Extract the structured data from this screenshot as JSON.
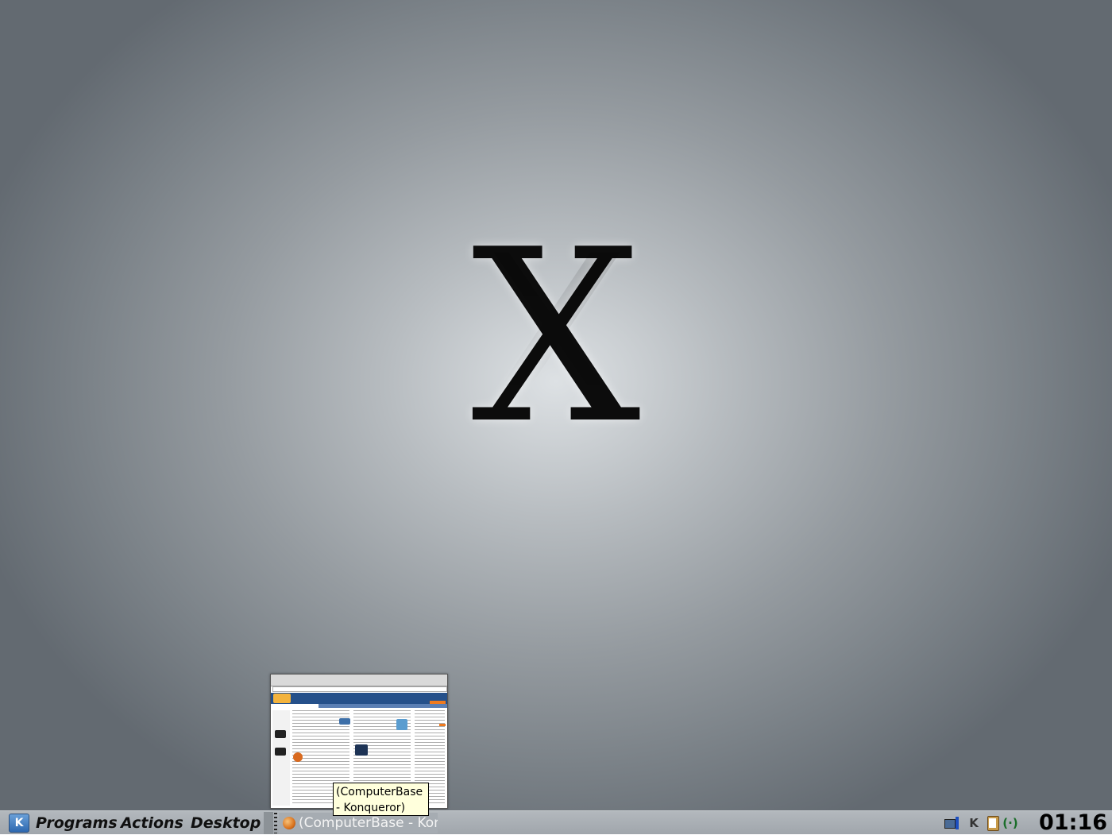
{
  "wallpaper": {
    "logo_glyph": "X",
    "background_center": "#dde1e4",
    "background_edge": "#636a71"
  },
  "task_preview": {
    "tooltip_text": "(ComputerBase - Konqueror)"
  },
  "taskbar": {
    "kmenu_glyph": "K",
    "menus": {
      "programs": "Programs",
      "actions": "Actions",
      "desktop": "Desktop"
    },
    "tasks": [
      {
        "label": "(ComputerBase - Konqueror)",
        "icon": "konqueror-icon"
      }
    ],
    "tray_icons": [
      "network-monitor-icon",
      "klipper-k-icon",
      "clipboard-icon",
      "volume-icon"
    ],
    "tray_glyphs": {
      "k": "K",
      "volume": "(·)"
    },
    "clock": "01:16"
  }
}
